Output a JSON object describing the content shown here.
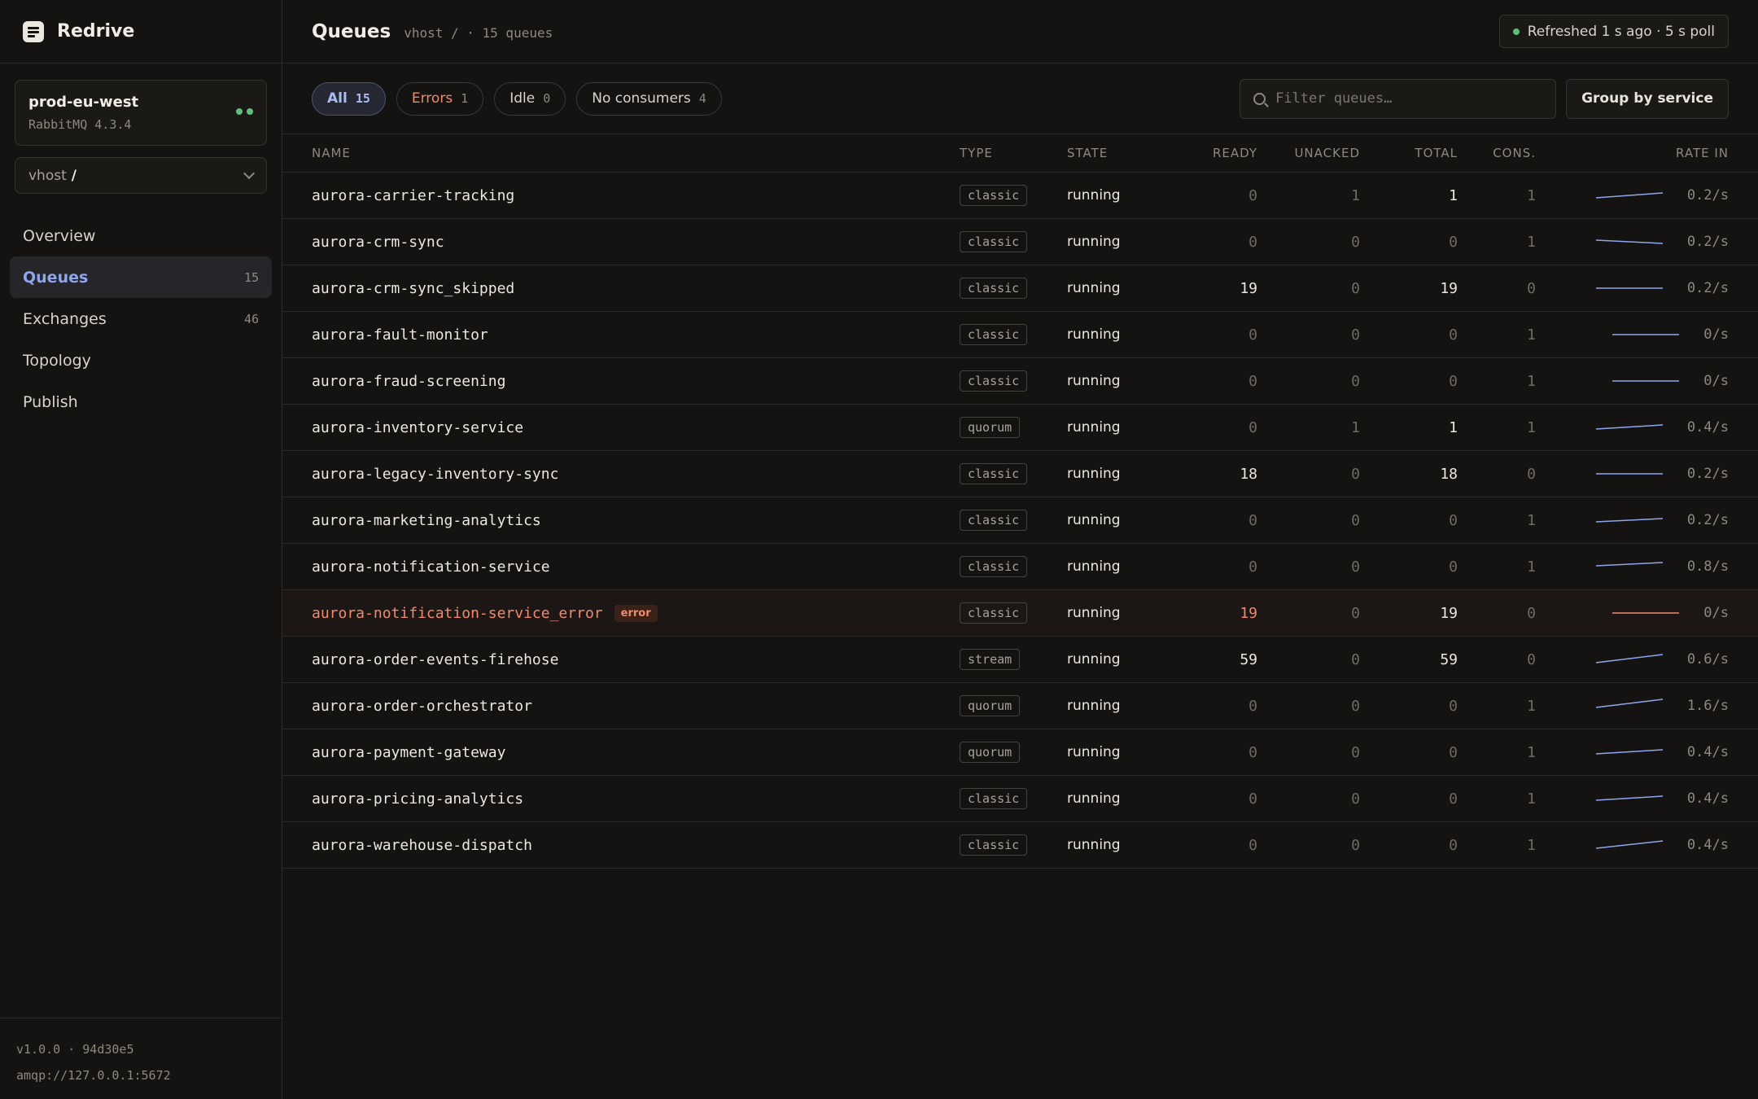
{
  "brand": {
    "name": "Redrive"
  },
  "connection": {
    "name": "prod-eu-west",
    "version": "RabbitMQ 4.3.4",
    "status_color": "#5fbf7a"
  },
  "vhost": {
    "label": "vhost",
    "value": "/"
  },
  "nav": {
    "overview": {
      "label": "Overview"
    },
    "queues": {
      "label": "Queues",
      "count": "15"
    },
    "exchanges": {
      "label": "Exchanges",
      "count": "46"
    },
    "topology": {
      "label": "Topology"
    },
    "publish": {
      "label": "Publish"
    }
  },
  "footer": {
    "version": "v1.0.0 · 94d30e5",
    "url": "amqp://127.0.0.1:5672"
  },
  "header": {
    "title": "Queues",
    "subtitle": "vhost / · 15 queues",
    "refresh": "Refreshed 1 s ago · 5 s poll"
  },
  "filters": {
    "all": {
      "label": "All",
      "count": "15"
    },
    "errors": {
      "label": "Errors",
      "count": "1"
    },
    "idle": {
      "label": "Idle",
      "count": "0"
    },
    "no_consumers": {
      "label": "No consumers",
      "count": "4"
    }
  },
  "search": {
    "placeholder": "Filter queues…",
    "value": ""
  },
  "group_button": {
    "label": "Group by service"
  },
  "columns": {
    "name": "NAME",
    "type": "TYPE",
    "state": "STATE",
    "ready": "READY",
    "unacked": "UNACKED",
    "total": "TOTAL",
    "cons": "CONS.",
    "rate": "RATE IN"
  },
  "accent": {
    "spark": "#8fa6ee",
    "error": "#f08a6e"
  },
  "queues": [
    {
      "name": "aurora-carrier-tracking",
      "type": "classic",
      "state": "running",
      "ready": "0",
      "unacked": "1",
      "total": "1",
      "cons": "1",
      "rate": "0.2/s",
      "spark": [
        0.35,
        0.65
      ]
    },
    {
      "name": "aurora-crm-sync",
      "type": "classic",
      "state": "running",
      "ready": "0",
      "unacked": "0",
      "total": "0",
      "cons": "1",
      "rate": "0.2/s",
      "spark": [
        0.6,
        0.4
      ]
    },
    {
      "name": "aurora-crm-sync_skipped",
      "type": "classic",
      "state": "running",
      "ready": "19",
      "unacked": "0",
      "total": "19",
      "cons": "0",
      "rate": "0.2/s",
      "spark": [
        0.5,
        0.5
      ]
    },
    {
      "name": "aurora-fault-monitor",
      "type": "classic",
      "state": "running",
      "ready": "0",
      "unacked": "0",
      "total": "0",
      "cons": "1",
      "rate": "0/s",
      "spark": [
        0.5,
        0.5
      ]
    },
    {
      "name": "aurora-fraud-screening",
      "type": "classic",
      "state": "running",
      "ready": "0",
      "unacked": "0",
      "total": "0",
      "cons": "1",
      "rate": "0/s",
      "spark": [
        0.5,
        0.5
      ]
    },
    {
      "name": "aurora-inventory-service",
      "type": "quorum",
      "state": "running",
      "ready": "0",
      "unacked": "1",
      "total": "1",
      "cons": "1",
      "rate": "0.4/s",
      "spark": [
        0.4,
        0.65
      ]
    },
    {
      "name": "aurora-legacy-inventory-sync",
      "type": "classic",
      "state": "running",
      "ready": "18",
      "unacked": "0",
      "total": "18",
      "cons": "0",
      "rate": "0.2/s",
      "spark": [
        0.5,
        0.5
      ]
    },
    {
      "name": "aurora-marketing-analytics",
      "type": "classic",
      "state": "running",
      "ready": "0",
      "unacked": "0",
      "total": "0",
      "cons": "1",
      "rate": "0.2/s",
      "spark": [
        0.4,
        0.6
      ]
    },
    {
      "name": "aurora-notification-service",
      "type": "classic",
      "state": "running",
      "ready": "0",
      "unacked": "0",
      "total": "0",
      "cons": "1",
      "rate": "0.8/s",
      "spark": [
        0.55,
        0.75
      ]
    },
    {
      "name": "aurora-notification-service_error",
      "type": "classic",
      "state": "running",
      "ready": "19",
      "unacked": "0",
      "total": "19",
      "cons": "0",
      "rate": "0/s",
      "error": true,
      "badge": "error",
      "spark": [
        0.5,
        0.5
      ]
    },
    {
      "name": "aurora-order-events-firehose",
      "type": "stream",
      "state": "running",
      "ready": "59",
      "unacked": "0",
      "total": "59",
      "cons": "0",
      "rate": "0.6/s",
      "spark": [
        0.3,
        0.8
      ]
    },
    {
      "name": "aurora-order-orchestrator",
      "type": "quorum",
      "state": "running",
      "ready": "0",
      "unacked": "0",
      "total": "0",
      "cons": "1",
      "rate": "1.6/s",
      "spark": [
        0.4,
        0.9
      ]
    },
    {
      "name": "aurora-payment-gateway",
      "type": "quorum",
      "state": "running",
      "ready": "0",
      "unacked": "0",
      "total": "0",
      "cons": "1",
      "rate": "0.4/s",
      "spark": [
        0.4,
        0.65
      ]
    },
    {
      "name": "aurora-pricing-analytics",
      "type": "classic",
      "state": "running",
      "ready": "0",
      "unacked": "0",
      "total": "0",
      "cons": "1",
      "rate": "0.4/s",
      "spark": [
        0.4,
        0.65
      ]
    },
    {
      "name": "aurora-warehouse-dispatch",
      "type": "classic",
      "state": "running",
      "ready": "0",
      "unacked": "0",
      "total": "0",
      "cons": "1",
      "rate": "0.4/s",
      "spark": [
        0.3,
        0.75
      ]
    }
  ]
}
